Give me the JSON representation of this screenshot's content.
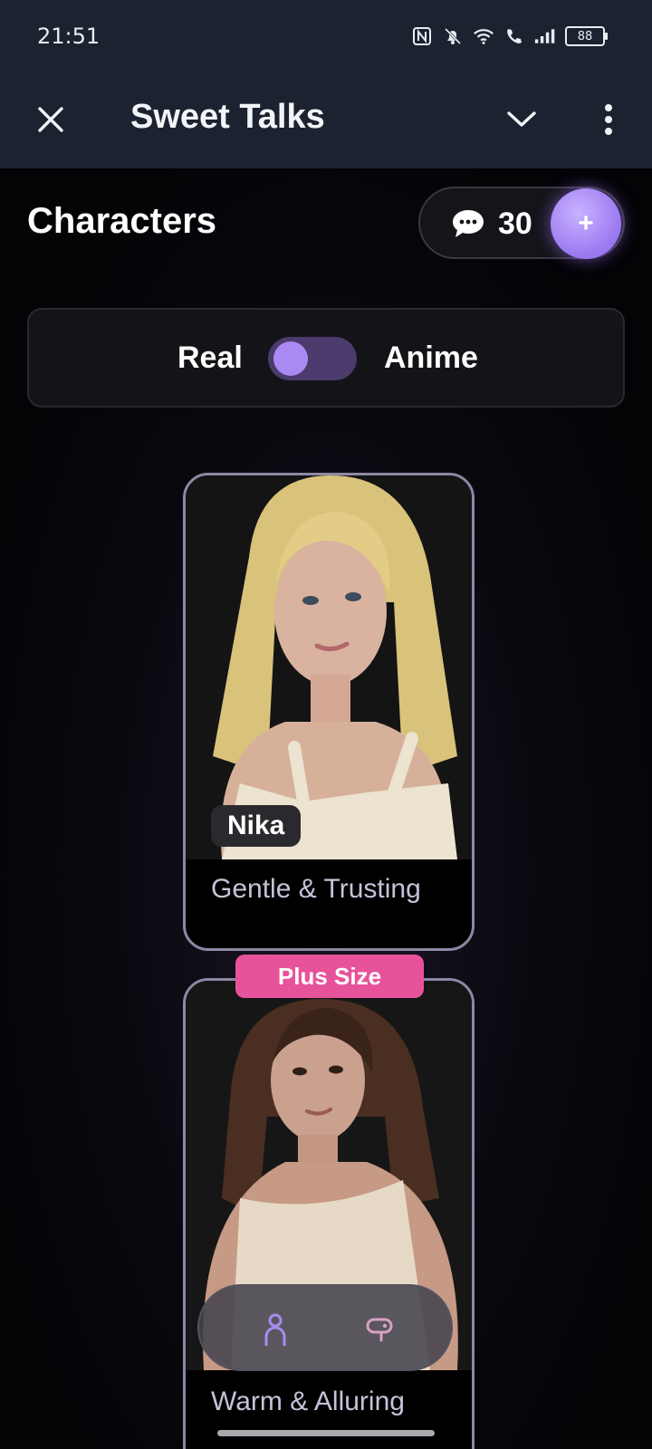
{
  "status_bar": {
    "time": "21:51",
    "battery": "88",
    "icons": [
      "nfc-icon",
      "bell-off-icon",
      "wifi-icon",
      "wifi-call-icon",
      "signal-icon",
      "battery-icon"
    ]
  },
  "app_bar": {
    "title": "Sweet Talks",
    "icons": [
      "close-icon",
      "chevron-down-icon",
      "more-vert-icon"
    ]
  },
  "header": {
    "title": "Characters",
    "credits": "30",
    "add_label": "+"
  },
  "toggle": {
    "left_label": "Real",
    "right_label": "Anime",
    "selected": "Real"
  },
  "cards": [
    {
      "name": "Nika",
      "description": "Gentle & Trusting",
      "badge": ""
    },
    {
      "name": "",
      "description": "Warm & Alluring",
      "badge": "Plus Size"
    }
  ],
  "bottom_nav": {
    "items": [
      "characters-icon",
      "chat-icon"
    ],
    "active": "characters-icon"
  },
  "colors": {
    "accent": "#a98af2",
    "badge_pink": "#e7539a",
    "appbar_bg": "#1c2330"
  }
}
